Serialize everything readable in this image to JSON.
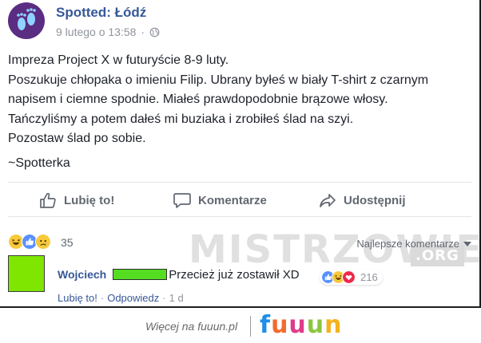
{
  "post": {
    "page_name": "Spotted: Łódź",
    "timestamp": "9 lutego o 13:58",
    "separator": "·",
    "lines": [
      "Impreza Project X w futuryście 8-9 luty.",
      "Poszukuje chłopaka o imieniu Filip. Ubrany byłeś w biały T-shirt z czarnym",
      "napisem i ciemne spodnie. Miałeś prawdopodobnie brązowe włosy.",
      "Tańczyliśmy a potem dałeś mi buziaka i zrobiłeś ślad na szyi.",
      "Pozostaw ślad po sobie.",
      "",
      "~Spotterka"
    ]
  },
  "actions": {
    "like_label": "Lubię to!",
    "comment_label": "Komentarze",
    "share_label": "Udostępnij"
  },
  "reactions": {
    "count": "35",
    "sort_label": "Najlepsze komentarze",
    "icons": [
      "haha-icon",
      "like-icon",
      "sad-icon"
    ]
  },
  "comment": {
    "author": "Wojciech",
    "text": "Przecież już zostawił XD",
    "reaction_count": "216",
    "like_label": "Lubię to!",
    "reply_label": "Odpowiedz",
    "time": "1 d",
    "separator": "·",
    "icons": [
      "like-icon",
      "haha-icon",
      "love-icon"
    ]
  },
  "watermark": {
    "text": "MISTRZOWIE",
    "suffix": ".ORG"
  },
  "footer": {
    "text": "Więcej na fuuun.pl",
    "logo_letters": [
      "f",
      "u",
      "u",
      "u",
      "n"
    ],
    "logo_colors": [
      "#1f8ee8",
      "#f26b2e",
      "#e03b8a",
      "#8cc63f",
      "#f5b21a"
    ]
  },
  "colors": {
    "link_blue": "#365899",
    "like_blue": "#5890ff",
    "haha_yellow": "#f7c93b",
    "love_red": "#f0284a",
    "avatar_purple": "#5a2d82",
    "redact_green": "#55dd22"
  }
}
